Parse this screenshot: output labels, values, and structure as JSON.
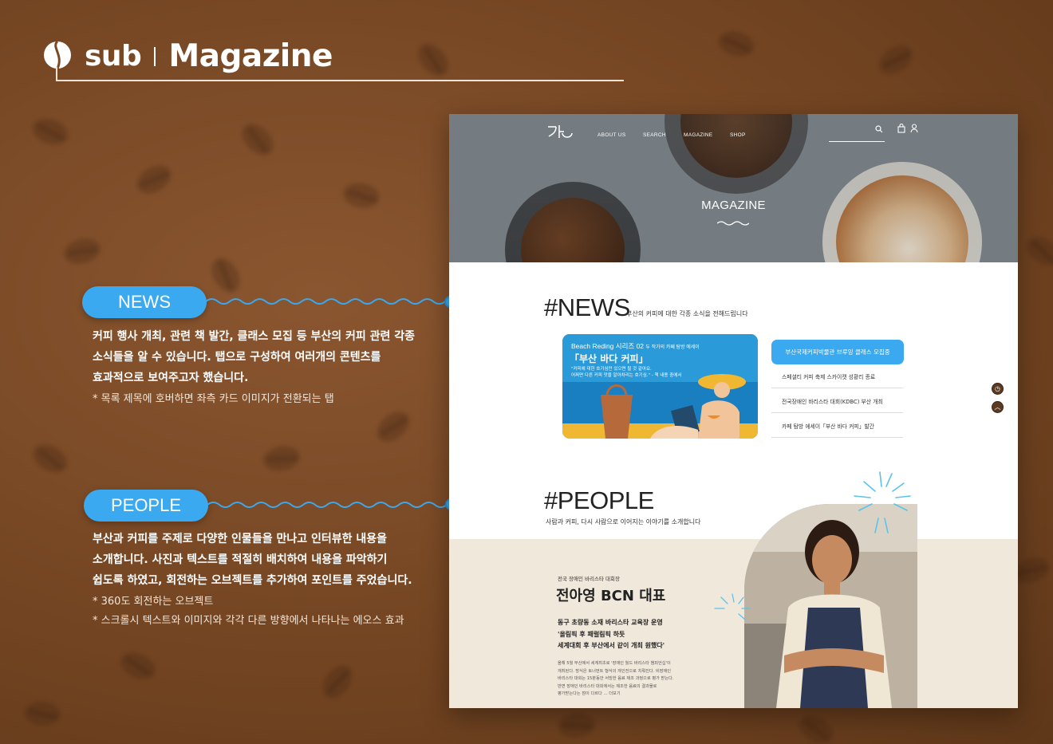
{
  "header": {
    "sub": "sub",
    "title": "Magazine"
  },
  "annotations": {
    "news": {
      "label": "NEWS",
      "lines": [
        "커피 행사 개최, 관련 책 발간, 클래스 모집 등 부산의 커피 관련 각종",
        "소식들을 알 수 있습니다. 탭으로 구성하여 여러개의 콘텐츠를",
        "효과적으로 보여주고자 했습니다."
      ],
      "note": "* 목록 제목에 호버하면 좌측 카드 이미지가 전환되는 탭"
    },
    "people": {
      "label": "PEOPLE",
      "lines": [
        "부산과 커피를 주제로 다양한 인물들을 만나고 인터뷰한 내용을",
        "소개합니다. 사진과 텍스트를 적절히 배치하여 내용을 파악하기",
        "쉽도록 하였고,  회전하는 오브젝트를 추가하여 포인트를 주었습니다."
      ],
      "notes": [
        "* 360도 회전하는 오브젝트",
        "* 스크롤시 텍스트와 이미지와 각각 다른 방향에서 나타나는 에오스 효과"
      ]
    }
  },
  "mockup": {
    "nav": {
      "items": [
        "ABOUT US",
        "SEARCH",
        "MAGAZINE",
        "SHOP"
      ]
    },
    "hero_title": "MAGAZINE",
    "news": {
      "heading": "#NEWS",
      "subtitle": "부산의 커피에 대한 각종 소식을 전해드립니다",
      "card": {
        "series": "Beach Reding 시리즈 02",
        "series_sub": "두 작가의 카페 탐방 에세이",
        "title": "「부산 바다 커피」",
        "quote_1": "\"커피에 대한 호기심만 있으면 될 것 같아요.",
        "quote_2": "어쩌면 다른 커피 맛을 알아차리는 호기심.\" - 책 내용 중에서"
      },
      "list": [
        "부산국제커피박물관 브루잉 클래스 모집중",
        "스페셜티 커피 축제 스카이캣 성황리 종료",
        "전국장애인 바리스타 대회(KDBC) 부산 개최",
        "카페 탐방 에세이「부산 바다 커피」발간"
      ]
    },
    "people": {
      "heading": "#PEOPLE",
      "subtitle": "사람과 커피, 다시 사람으로 이어지는 이야기를 소개합니다",
      "small_title": "전국 장애인 바리스타 대회장",
      "name": "전아영 BCN 대표",
      "quote": [
        "동구 초량동 소재 바리스타 교육장 운영",
        "'올림픽 후 패럴림픽 하듯",
        "세계대회 후 부산에서 같이 개최 원했다'"
      ],
      "body": [
        "올해 5월 부산에서 세계최초로 '장애인 월드 바리스타 챔피언십'이",
        "개최된다. 방식은 토너먼트 형식의 개인전으로 치뤄진다. 비장애인",
        "바리스타 대회는 15분동안 서빙한 음료 제조 과정으로 평가 받는다.",
        "반면 장애인 바리스타 대회에서는 제조한 음료의 결과물로",
        "평가받는다는 점이 다르다 … 더보기"
      ]
    }
  }
}
